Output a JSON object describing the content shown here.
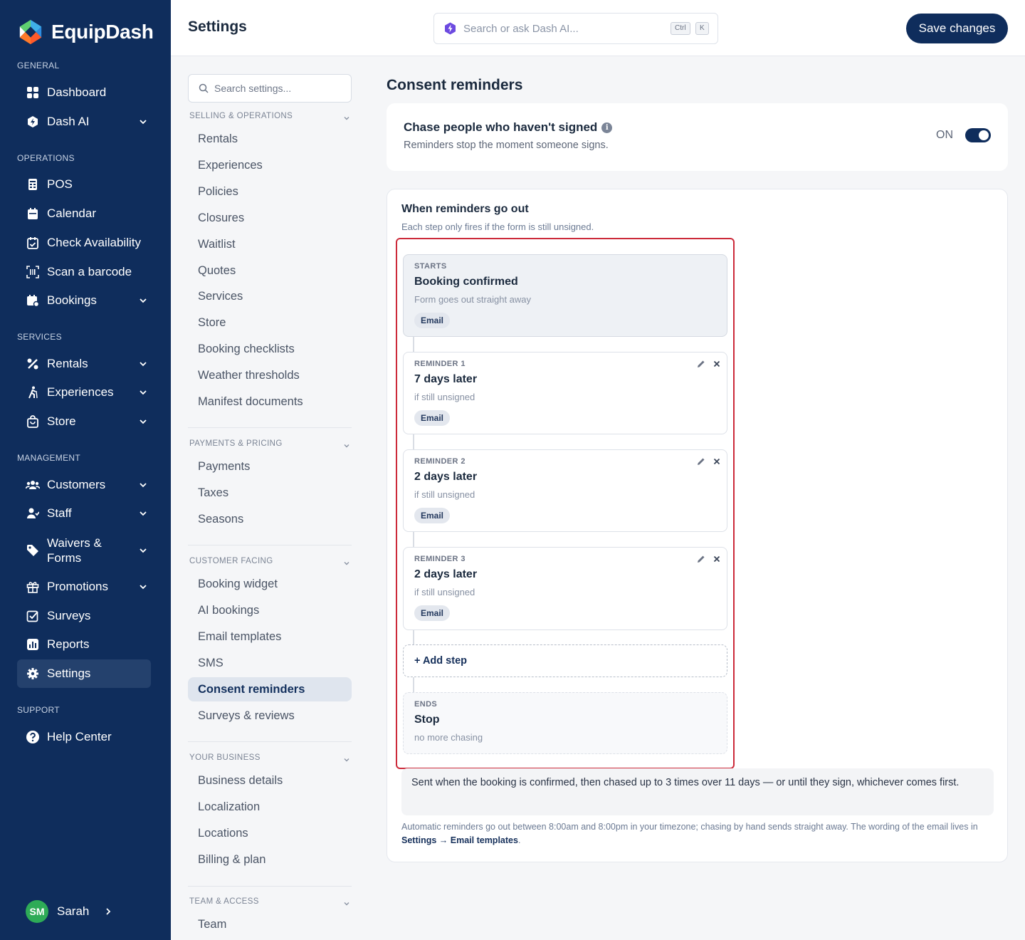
{
  "brand": {
    "name": "EquipDash"
  },
  "nav": {
    "sections": {
      "general": "GENERAL",
      "operations": "OPERATIONS",
      "services": "SERVICES",
      "management": "MANAGEMENT",
      "support": "SUPPORT"
    },
    "items": {
      "dashboard": "Dashboard",
      "dash_ai": "Dash AI",
      "pos": "POS",
      "calendar": "Calendar",
      "check_availability": "Check Availability",
      "scan_barcode": "Scan a barcode",
      "bookings": "Bookings",
      "rentals": "Rentals",
      "experiences": "Experiences",
      "store": "Store",
      "customers": "Customers",
      "staff": "Staff",
      "waivers_line1": "Waivers &",
      "waivers_line2": "Forms",
      "promotions": "Promotions",
      "surveys": "Surveys",
      "reports": "Reports",
      "settings": "Settings",
      "help_center": "Help Center"
    },
    "user": {
      "initials": "SM",
      "name": "Sarah"
    }
  },
  "header": {
    "title": "Settings",
    "search_placeholder": "Search or ask Dash AI...",
    "kbd_ctrl": "Ctrl",
    "kbd_k": "K",
    "save_label": "Save changes"
  },
  "settings_menu": {
    "search_placeholder": "Search settings...",
    "groups": {
      "selling": "SELLING & OPERATIONS",
      "payments": "PAYMENTS & PRICING",
      "customer": "CUSTOMER FACING",
      "business": "YOUR BUSINESS",
      "team": "TEAM & ACCESS"
    },
    "selling_items": [
      "Rentals",
      "Experiences",
      "Policies",
      "Closures",
      "Waitlist",
      "Quotes",
      "Services",
      "Store",
      "Booking checklists",
      "Weather thresholds",
      "Manifest documents"
    ],
    "payments_items": [
      "Payments",
      "Taxes",
      "Seasons"
    ],
    "customer_items": [
      "Booking widget",
      "AI bookings",
      "Email templates",
      "SMS",
      "Consent reminders",
      "Surveys & reviews"
    ],
    "business_items": [
      "Business details",
      "Localization",
      "Locations",
      "Billing & plan"
    ],
    "team_items": [
      "Team"
    ]
  },
  "main": {
    "title": "Consent reminders",
    "toggle": {
      "title": "Chase people who haven't signed",
      "info_glyph": "i",
      "subtitle": "Reminders stop the moment someone signs.",
      "state_label": "ON",
      "enabled": true
    },
    "flow": {
      "title": "When reminders go out",
      "subtitle": "Each step only fires if the form is still unsigned.",
      "start": {
        "tag": "STARTS",
        "title": "Booking confirmed",
        "subtitle": "Form goes out straight away",
        "channel": "Email"
      },
      "reminders": [
        {
          "tag": "REMINDER 1",
          "title": "7 days later",
          "subtitle": "if still unsigned",
          "channel": "Email"
        },
        {
          "tag": "REMINDER 2",
          "title": "2 days later",
          "subtitle": "if still unsigned",
          "channel": "Email"
        },
        {
          "tag": "REMINDER 3",
          "title": "2 days later",
          "subtitle": "if still unsigned",
          "channel": "Email"
        }
      ],
      "add_step_label": "+ Add step",
      "end": {
        "tag": "ENDS",
        "title": "Stop",
        "subtitle": "no more chasing"
      },
      "summary": "Sent when the booking is confirmed, then chased up to 3 times over 11 days — or until they sign, whichever comes first.",
      "footnote_text": "Automatic reminders go out between 8:00am and 8:00pm in your timezone; chasing by hand sends straight away. The wording of the email lives in ",
      "footnote_link": "Settings → Email templates",
      "footnote_end": "."
    }
  },
  "colors": {
    "nav_bg": "#0f2d5c",
    "accent": "#0f2d5c",
    "highlight_border": "#cc2a3a",
    "avatar": "#2eab57"
  }
}
